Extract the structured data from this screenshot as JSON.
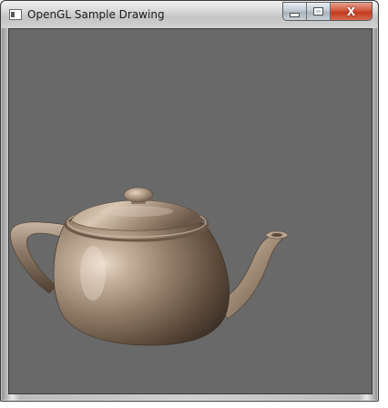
{
  "window": {
    "title": "OpenGL Sample Drawing",
    "icons": {
      "app": "app-window-icon",
      "minimize": "minimize-icon",
      "maximize": "maximize-icon",
      "close": "close-icon"
    },
    "close_label": "X"
  },
  "viewport": {
    "background_color": "#696969",
    "object": "teapot",
    "object_color": "#9c8772"
  }
}
